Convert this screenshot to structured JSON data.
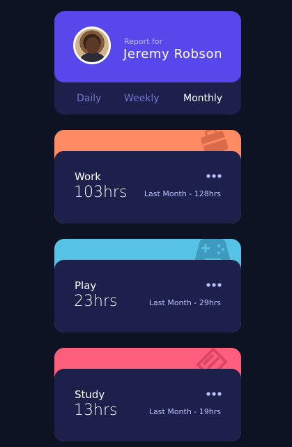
{
  "profile": {
    "report_label": "Report for",
    "name": "Jeremy Robson"
  },
  "periods": {
    "daily": "Daily",
    "weekly": "Weekly",
    "monthly": "Monthly",
    "selected": "Monthly"
  },
  "activities": [
    {
      "title": "Work",
      "hours": "103hrs",
      "previous": "Last Month - 128hrs",
      "color": "#ff8b64",
      "icon": "briefcase-icon"
    },
    {
      "title": "Play",
      "hours": "23hrs",
      "previous": "Last Month - 29hrs",
      "color": "#55c2e6",
      "icon": "gamepad-icon"
    },
    {
      "title": "Study",
      "hours": "13hrs",
      "previous": "Last Month - 19hrs",
      "color": "#ff5e7d",
      "icon": "books-icon"
    }
  ],
  "colors": {
    "background": "#0e1323",
    "card": "#1c204b",
    "accent": "#5847eb"
  }
}
